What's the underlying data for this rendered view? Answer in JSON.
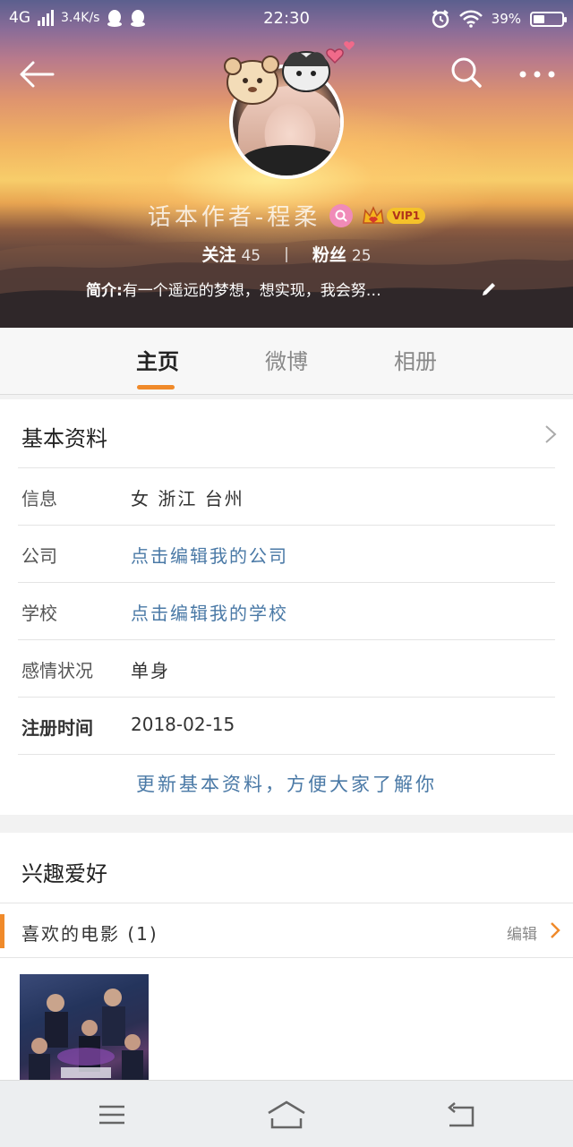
{
  "status_bar": {
    "network": "4G",
    "speed": "3.4K/s",
    "time": "22:30",
    "battery": "39%",
    "battery_level": 0.39
  },
  "profile": {
    "name": "话本作者-程柔",
    "vip_label": "VIP1",
    "follow_label": "关注",
    "follow_count": "45",
    "fans_label": "粉丝",
    "fans_count": "25",
    "bio_label": "简介:",
    "bio_text": "有一个遥远的梦想，想实现，我会努…"
  },
  "tabs": [
    {
      "label": "主页",
      "active": true
    },
    {
      "label": "微博",
      "active": false
    },
    {
      "label": "相册",
      "active": false
    }
  ],
  "basic_info": {
    "title": "基本资料",
    "rows": [
      {
        "label": "信息",
        "value": "女  浙江 台州",
        "is_link": false
      },
      {
        "label": "公司",
        "value": "点击编辑我的公司",
        "is_link": true
      },
      {
        "label": "学校",
        "value": "点击编辑我的学校",
        "is_link": true
      },
      {
        "label": "感情状况",
        "value": "单身",
        "is_link": false
      },
      {
        "label": "注册时间",
        "value": "2018-02-15",
        "is_link": false
      }
    ],
    "update_link": "更新基本资料，方便大家了解你"
  },
  "interests": {
    "title": "兴趣爱好",
    "movies_label": "喜欢的电影 (1)",
    "edit_label": "编辑"
  },
  "colors": {
    "accent": "#f08a2a",
    "link": "#4a79a6"
  },
  "icons": [
    "back-arrow-icon",
    "search-icon",
    "more-icon",
    "search-badge-icon",
    "crown-icon",
    "pencil-icon",
    "chevron-right-icon",
    "menu-icon",
    "home-icon",
    "back-icon"
  ]
}
